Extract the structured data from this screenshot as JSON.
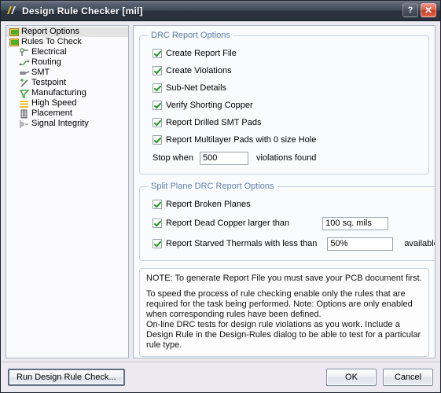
{
  "window": {
    "title": "Design Rule Checker [mil]",
    "app_icon": "altium-logo-icon",
    "help_label": "?",
    "close_label": "✕"
  },
  "tree": {
    "items": [
      {
        "label": "Report Options",
        "icon": "folder-icon",
        "depth": 0,
        "selected": true
      },
      {
        "label": "Rules To Check",
        "icon": "folder-icon",
        "depth": 0,
        "selected": false
      },
      {
        "label": "Electrical",
        "icon": "electrical-icon",
        "depth": 1,
        "selected": false
      },
      {
        "label": "Routing",
        "icon": "routing-icon",
        "depth": 1,
        "selected": false
      },
      {
        "label": "SMT",
        "icon": "smt-icon",
        "depth": 1,
        "selected": false
      },
      {
        "label": "Testpoint",
        "icon": "testpoint-icon",
        "depth": 1,
        "selected": false
      },
      {
        "label": "Manufacturing",
        "icon": "manufacturing-icon",
        "depth": 1,
        "selected": false
      },
      {
        "label": "High Speed",
        "icon": "high-speed-icon",
        "depth": 1,
        "selected": false
      },
      {
        "label": "Placement",
        "icon": "placement-icon",
        "depth": 1,
        "selected": false
      },
      {
        "label": "Signal Integrity",
        "icon": "signal-integrity-icon",
        "depth": 1,
        "selected": false
      }
    ]
  },
  "drc_report_options": {
    "legend": "DRC Report Options",
    "checkboxes": [
      {
        "label": "Create Report File",
        "accel": "F",
        "checked": true
      },
      {
        "label": "Create Violations",
        "accel": "a",
        "checked": true
      },
      {
        "label": "Sub-Net Details",
        "accel": "N",
        "checked": true
      },
      {
        "label": "Verify Shorting Copper",
        "accel": "",
        "checked": true
      },
      {
        "label": "Report Drilled SMT Pads",
        "accel": "D",
        "checked": true
      },
      {
        "label": "Report Multilayer Pads with 0 size Hole",
        "accel": "M",
        "checked": true
      }
    ],
    "stop_when_label": "Stop when",
    "stop_when_accel": "e",
    "stop_when_value": "500",
    "stop_when_suffix": "violations found"
  },
  "split_plane_options": {
    "legend": "Split Plane DRC Report Options",
    "broken_planes_label": "Report Broken Planes",
    "broken_planes_checked": true,
    "dead_copper_label": "Report Dead Copper larger than",
    "dead_copper_checked": true,
    "dead_copper_value": "100 sq. mils",
    "starved_thermals_label": "Report Starved Thermals with less than",
    "starved_thermals_checked": true,
    "starved_thermals_value": "50%",
    "starved_thermals_suffix": "available copper"
  },
  "note": {
    "line1": "NOTE: To generate Report File you must save your PCB document first.",
    "line2": "To speed the process of rule checking enable only the rules that are required for the task being performed.  Note: Options are only enabled when corresponding rules have been defined.",
    "line3": "On-line DRC tests for design rule violations as you work. Include a Design Rule in the Design-Rules dialog to be able to test for a particular rule  type."
  },
  "footer": {
    "run_label": "Run Design Rule Check...",
    "run_accel": "R",
    "ok_label": "OK",
    "cancel_label": "Cancel"
  },
  "colors": {
    "titlebar_dark": "#2a3340",
    "titlebar_light": "#7b8491",
    "close_red": "#e15a44",
    "group_legend": "#5f7fae",
    "check_green": "#1e9c1e",
    "dialog_bg": "#ece9f0"
  }
}
